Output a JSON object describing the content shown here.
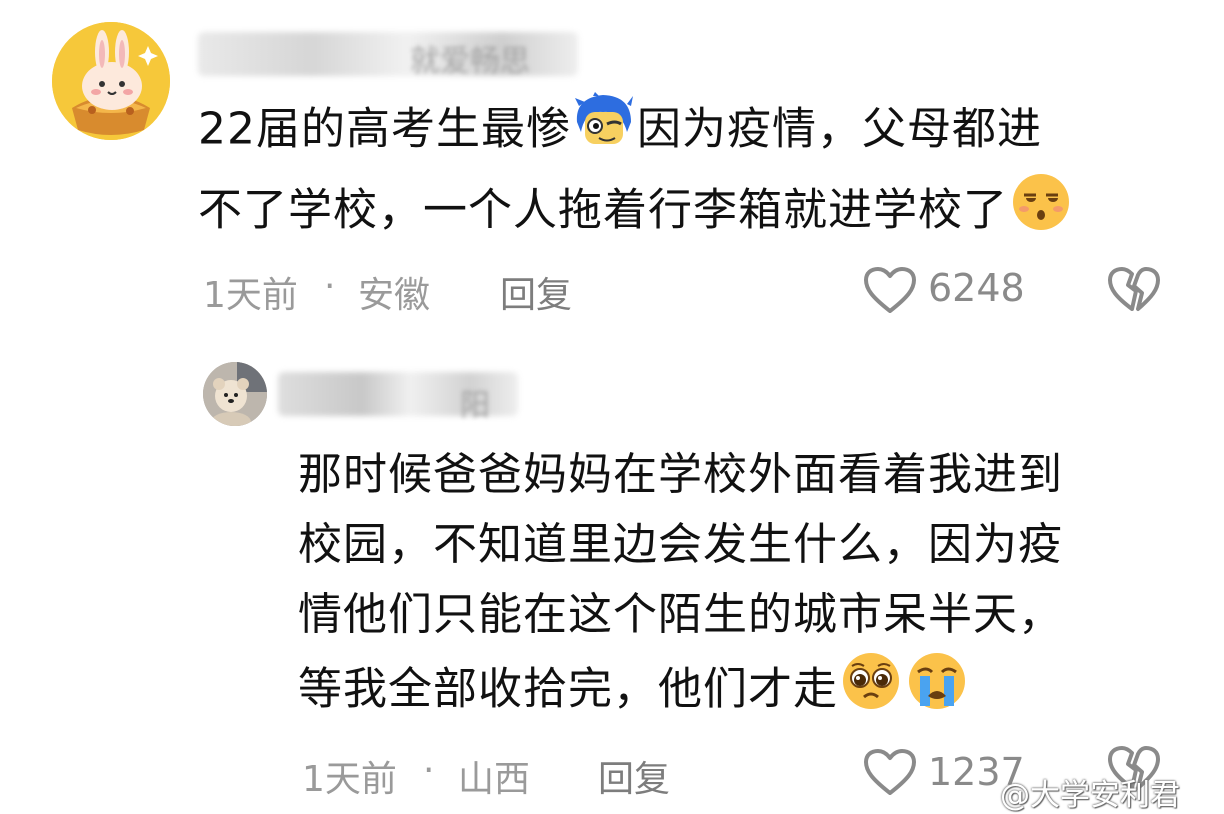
{
  "comments": [
    {
      "user_name": "就爱畅思",
      "text": "22届的高考生最惨",
      "text_after_emoji": "因为疫情，父母都进",
      "text_line2": "不了学校，一个人拖着行李箱就进学校了",
      "time": "1天前",
      "separator": "·",
      "location": "安徽",
      "reply_label": "回复",
      "likes": "6248"
    },
    {
      "user_name": "阳",
      "text_lines": [
        "那时候爸爸妈妈在学校外面看着我进到",
        "校园，不知道里边会发生什么，因为疫",
        "情他们只能在这个陌生的城市呆半天，",
        "等我全部收拾完，他们才走"
      ],
      "time": "1天前",
      "separator": "·",
      "location": "山西",
      "reply_label": "回复",
      "likes": "1237"
    }
  ],
  "watermark": "@大学安利君",
  "icons": {
    "like": "heart-outline-icon",
    "dislike": "broken-heart-icon",
    "emoji_1": "blue-hair-face-emoji",
    "emoji_2": "unamused-face-emoji",
    "emoji_3": "pleading-face-emoji",
    "emoji_4": "crying-face-emoji"
  },
  "colors": {
    "meta_gray": "#9a9a9a",
    "count_gray": "#8a8a8a",
    "avatar_yellow": "#f6c83a"
  }
}
